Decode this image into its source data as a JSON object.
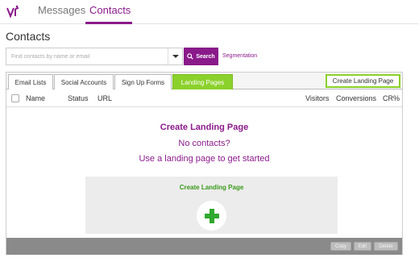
{
  "nav": {
    "messages": "Messages",
    "contacts": "Contacts",
    "accent_color": "#8a1a8a"
  },
  "page_title": "Contacts",
  "search": {
    "placeholder": "Find contacts by name or email",
    "value": "",
    "button_label": "Search",
    "segmentation_label": "Segmentation"
  },
  "tabs": [
    {
      "label": "Email Lists",
      "active": false
    },
    {
      "label": "Social Accounts",
      "active": false
    },
    {
      "label": "Sign Up Forms",
      "active": false
    },
    {
      "label": "Landing Pages",
      "active": true
    }
  ],
  "create_landing_page_button": "Create Landing Page",
  "table": {
    "columns": [
      "Name",
      "Status",
      "URL",
      "Visitors",
      "Conversions",
      "CR%"
    ]
  },
  "empty_state": {
    "title": "Create Landing Page",
    "line1": "No contacts?",
    "line2": "Use a landing page to get started",
    "panel_title": "Create Landing Page"
  },
  "footer": {
    "copy": "Copy",
    "edit": "Edit",
    "delete": "Delete"
  },
  "colors": {
    "brand_purple": "#8a1a8a",
    "active_tab_green": "#8bd12b",
    "plus_green": "#2fa82f",
    "footer_gray": "#8a8a8a"
  }
}
